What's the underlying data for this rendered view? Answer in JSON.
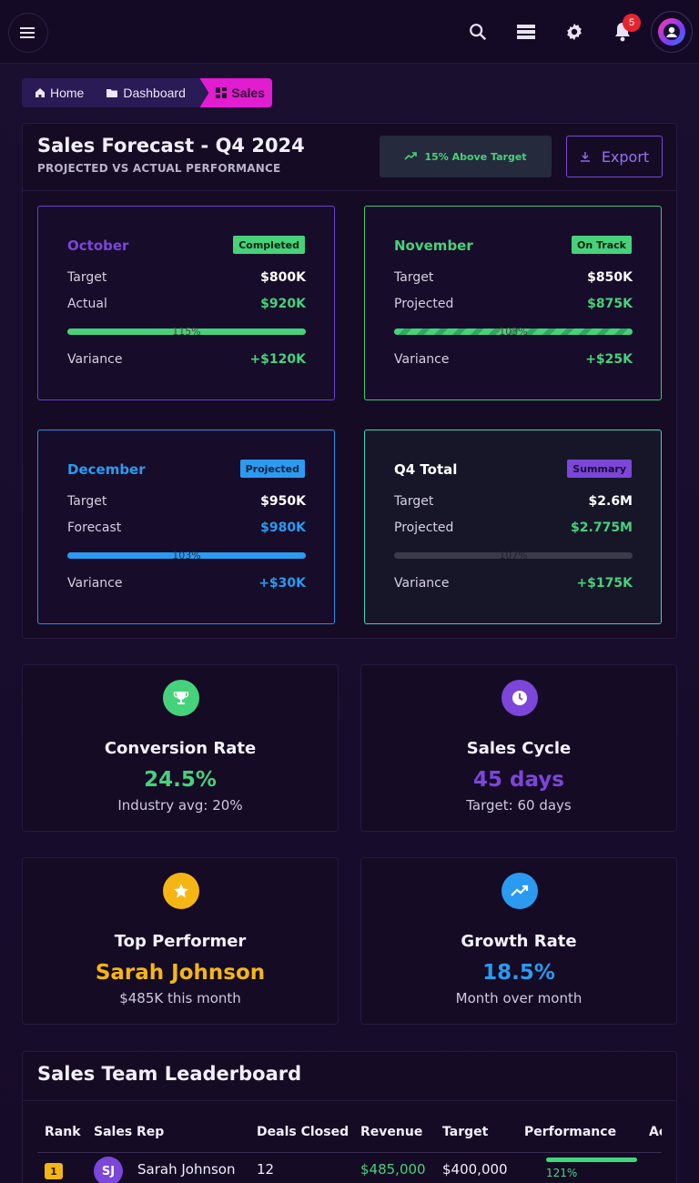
{
  "topbar": {
    "notification_count": "5",
    "icons": [
      "menu-icon",
      "search-icon",
      "stack-icon",
      "gear-icon",
      "bell-icon",
      "avatar"
    ]
  },
  "breadcrumb": {
    "items": [
      {
        "label": "Home",
        "icon": "home-icon"
      },
      {
        "label": "Dashboard",
        "icon": "folder-icon"
      },
      {
        "label": "Sales",
        "icon": "grid-icon"
      }
    ]
  },
  "forecast": {
    "title": "Sales Forecast - Q4 2024",
    "subtitle": "PROJECTED VS ACTUAL PERFORMANCE",
    "status": "15% Above Target",
    "export_label": "Export",
    "cards": [
      {
        "name": "October",
        "tag": "Completed",
        "row1_label": "Target",
        "row1_value": "$800K",
        "row2_label": "Actual",
        "row2_value": "$920K",
        "progress_label": "115%",
        "progress": 1.0,
        "variance_label": "Variance",
        "variance_value": "+$120K",
        "accent": "#7b46d9"
      },
      {
        "name": "November",
        "tag": "On Track",
        "row1_label": "Target",
        "row1_value": "$850K",
        "row2_label": "Projected",
        "row2_value": "$875K",
        "progress_label": "103%",
        "progress": 1.0,
        "variance_label": "Variance",
        "variance_value": "+$25K",
        "accent": "#46d27a"
      },
      {
        "name": "December",
        "tag": "Projected",
        "row1_label": "Target",
        "row1_value": "$950K",
        "row2_label": "Forecast",
        "row2_value": "$980K",
        "progress_label": "103%",
        "progress": 1.0,
        "variance_label": "Variance",
        "variance_value": "+$30K",
        "accent": "#2a9bf0"
      },
      {
        "name": "Q4 Total",
        "tag": "Summary",
        "row1_label": "Target",
        "row1_value": "$2.6M",
        "row2_label": "Projected",
        "row2_value": "$2.775M",
        "progress_label": "107%",
        "progress": 0,
        "variance_label": "Variance",
        "variance_value": "+$175K",
        "accent": "#7b46d9"
      }
    ]
  },
  "stats": {
    "conversion": {
      "title": "Conversion Rate",
      "value": "24.5%",
      "sub": "Industry avg: 20%",
      "icon": "trophy-icon",
      "color": "#46d27a"
    },
    "cycle": {
      "title": "Sales Cycle",
      "value": "45 days",
      "sub": "Target: 60 days",
      "icon": "clock-icon",
      "color": "#7b46d9"
    },
    "top": {
      "title": "Top Performer",
      "value": "Sarah Johnson",
      "sub": "$485K this month",
      "icon": "star-icon",
      "color": "#f5b614"
    },
    "growth": {
      "title": "Growth Rate",
      "value": "18.5%",
      "sub": "Month over month",
      "icon": "trending-up-icon",
      "color": "#2a9bf0"
    }
  },
  "leaderboard": {
    "title": "Sales Team Leaderboard",
    "columns": [
      "Rank",
      "Sales Rep",
      "Deals Closed",
      "Revenue",
      "Target",
      "Performance",
      "Ac"
    ],
    "rows": [
      {
        "rank": "1",
        "initials": "SJ",
        "name": "Sarah Johnson",
        "deals": "12",
        "revenue": "$485,000",
        "target": "$400,000",
        "performance": "121%"
      }
    ]
  }
}
